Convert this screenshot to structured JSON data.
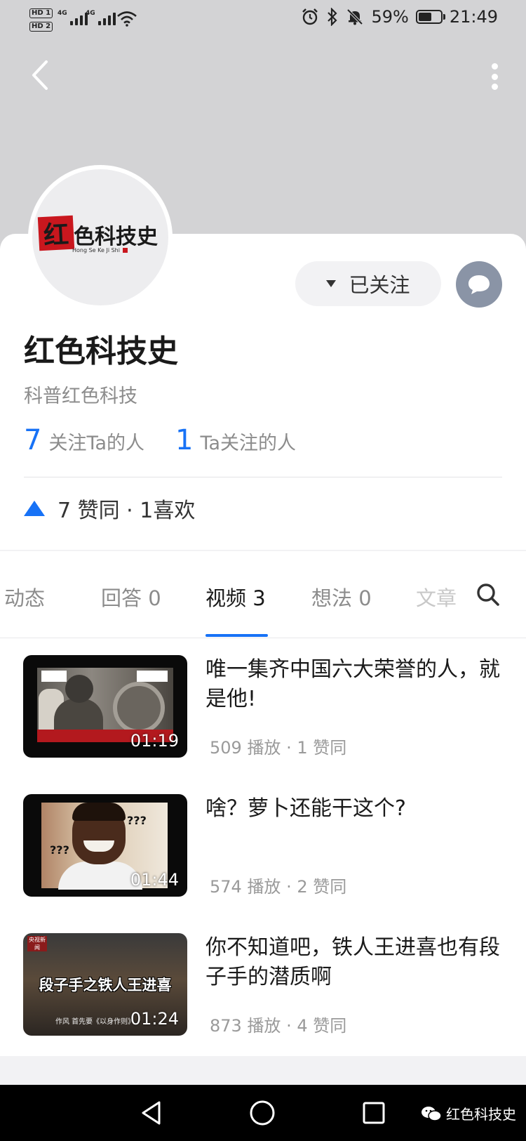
{
  "status_bar": {
    "hd1": "HD 1",
    "hd2": "HD 2",
    "net1": "4G",
    "net2": "4G",
    "battery": "59%",
    "battery_level": 0.59,
    "time": "21:49"
  },
  "profile": {
    "logo_chars_red": "红",
    "logo_chars": "色科技史",
    "logo_pinyin": "Hong Se Ke Ji Shi",
    "follow_button": "已关注",
    "name": "红色科技史",
    "bio": "科普红色科技",
    "followers_count": "7",
    "followers_label": "关注Ta的人",
    "following_count": "1",
    "following_label": "Ta关注的人",
    "likes_summary": "7 赞同 · 1喜欢"
  },
  "tabs": [
    {
      "label": "动态",
      "state": "normal"
    },
    {
      "label": "回答 0",
      "state": "normal"
    },
    {
      "label": "视频 3",
      "state": "active"
    },
    {
      "label": "想法 0",
      "state": "normal"
    },
    {
      "label": "文章",
      "state": "faded"
    }
  ],
  "videos": [
    {
      "title": "唯一集齐中国六大荣誉的人，就是他!",
      "duration": "01:19",
      "meta": "509 播放 · 1 赞同"
    },
    {
      "title": "啥？萝卜还能干这个?",
      "duration": "01:44",
      "meta": "574 播放 · 2 赞同",
      "thumb_marks": [
        "???",
        "???"
      ]
    },
    {
      "title": "你不知道吧，铁人王进喜也有段子手的潜质啊",
      "duration": "01:24",
      "meta": "873 播放 · 4 赞同",
      "thumb_badge": "央视新闻",
      "thumb_subtitle": "段子手之铁人王进喜",
      "thumb_caption": "作风 首先要《以身作则》"
    }
  ],
  "watermark": "红色科技史",
  "colors": {
    "accent": "#1772f6",
    "header_gray": "#d3d3d5",
    "logo_red": "#c9171e",
    "message_button": "#8a94a6"
  }
}
